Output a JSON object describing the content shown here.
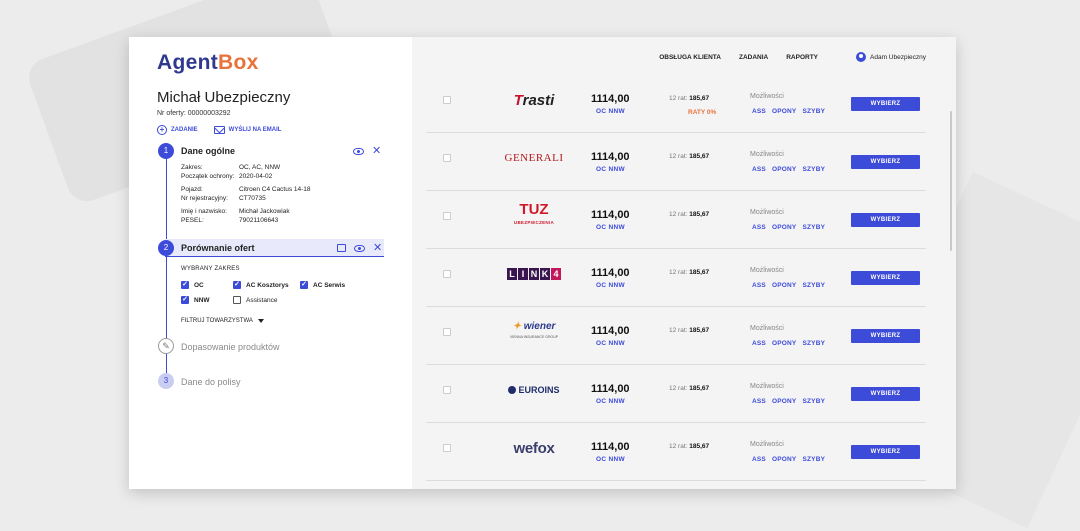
{
  "app": {
    "logo_part1": "Agent",
    "logo_part2": "Box"
  },
  "client": {
    "name": "Michał Ubezpieczny",
    "offer_number": "Nr oferty: 00000003292"
  },
  "actions": {
    "task": "ZADANIE",
    "email": "WYŚLIJ NA EMAIL"
  },
  "steps": [
    {
      "number": "1",
      "title": "Dane ogólne"
    },
    {
      "number": "2",
      "title": "Porównanie ofert"
    },
    {
      "title": "Dopasowanie produktów"
    },
    {
      "number": "3",
      "title": "Dane do polisy"
    }
  ],
  "details": {
    "zakres_label": "Zakres:",
    "zakres": "OC, AC, NNW",
    "start_label": "Początek ochrony:",
    "start": "2020-04-02",
    "vehicle_label": "Pojazd:",
    "vehicle": "Citroen C4 Cactus 14-18",
    "reg_label": "Nr rejestracyjny:",
    "reg": "CT70735",
    "person_label": "Imię i nazwisko:",
    "person": "Michał Jackowiak",
    "pesel_label": "PESEL:",
    "pesel": "79021106643"
  },
  "scope": {
    "heading": "WYBRANY ZAKRES",
    "options": [
      {
        "label": "OC",
        "checked": true
      },
      {
        "label": "AC Kosztorys",
        "checked": true
      },
      {
        "label": "AC Serwis",
        "checked": true
      },
      {
        "label": "NNW",
        "checked": true
      },
      {
        "label": "Assistance",
        "checked": false
      }
    ],
    "filter": "FILTRUJ TOWARZYSTWA"
  },
  "nav": {
    "items": [
      "OBSŁUGA KLIENTA",
      "ZADANIA",
      "RAPORTY"
    ],
    "user": "Adam Ubezpieczny"
  },
  "offer_common": {
    "price": "1114,00",
    "coverage": "OC  NNW",
    "installments_label": "12 rat:",
    "installments_value": "185,67",
    "options_label": "Możliwości",
    "extras": [
      "ASS",
      "OPONY",
      "SZYBY"
    ],
    "button": "WYBIERZ"
  },
  "offers": [
    {
      "insurer": "Trasti",
      "logo_text": "rasti",
      "logo_mark": "T",
      "extra_note": "RATY 0%"
    },
    {
      "insurer": "Generali",
      "logo_text": "GENERALI"
    },
    {
      "insurer": "TUZ",
      "logo_text": "TUZ",
      "logo_sub": "UBEZPIECZENIA"
    },
    {
      "insurer": "LINK4",
      "logo_letters": [
        "L",
        "I",
        "N",
        "K",
        "4"
      ]
    },
    {
      "insurer": "Wiener",
      "logo_text": "wiener",
      "logo_sub": "VIENNA INSURANCE GROUP"
    },
    {
      "insurer": "Euroins",
      "logo_text": "EUROINS"
    },
    {
      "insurer": "wefox",
      "logo_text": "wefox"
    }
  ],
  "colors": {
    "primary": "#3d4bd9",
    "accent": "#e8733a",
    "brand_dark": "#2f3a8f"
  }
}
